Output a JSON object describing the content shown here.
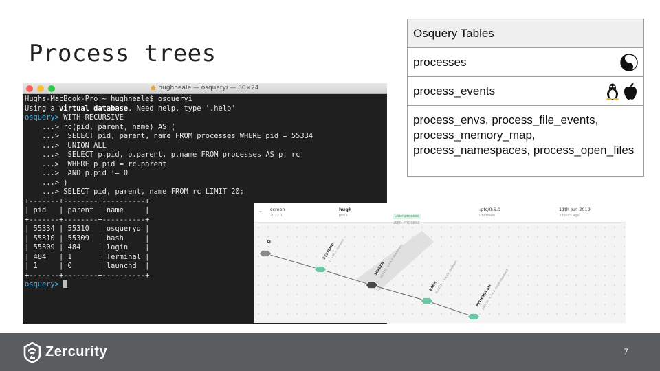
{
  "slide": {
    "title": "Process trees",
    "page_number": "7"
  },
  "terminal": {
    "window_title": "hughneale — osqueryi — 80×24",
    "lines": [
      "Hughs-MacBook-Pro:~ hughneale$ osqueryi",
      "Using a virtual database. Need help, type '.help'",
      "osquery> WITH RECURSIVE",
      "    ...> rc(pid, parent, name) AS (",
      "    ...>  SELECT pid, parent, name FROM processes WHERE pid = 55334",
      "    ...>  UNION ALL",
      "    ...>  SELECT p.pid, p.parent, p.name FROM processes AS p, rc",
      "    ...>  WHERE p.pid = rc.parent",
      "    ...>  AND p.pid != 0",
      "    ...> )",
      "    ...> SELECT pid, parent, name FROM rc LIMIT 20;",
      "+-------+--------+----------+",
      "| pid   | parent | name     |",
      "+-------+--------+----------+",
      "| 55334 | 55310  | osqueryd |",
      "| 55310 | 55309  | bash     |",
      "| 55309 | 484    | login    |",
      "| 484   | 1      | Terminal |",
      "| 1     | 0      | launchd  |",
      "+-------+--------+----------+",
      "osquery> "
    ]
  },
  "tables": {
    "header": "Osquery Tables",
    "rows": [
      {
        "text": "processes",
        "icons": [
          "yin-yang-icon"
        ]
      },
      {
        "text": "process_events",
        "icons": [
          "linux-tux-icon",
          "apple-icon"
        ]
      },
      {
        "text": "process_envs, process_file_events, process_memory_map, process_namespaces, process_open_files",
        "icons": []
      }
    ]
  },
  "process_graph": {
    "header": {
      "name": "screen",
      "pid": "207370",
      "user": "hugh",
      "tty": "pts/3",
      "type_badge": "User process",
      "type_code": "USER_PROCESS",
      "terminal": ":pts/0:S.0",
      "terminal_sub": "Unknown",
      "date": "11th Jun 2019",
      "date_sub": "3 hours ago"
    },
    "nodes": [
      {
        "label": "0",
        "sub": "",
        "color": "#8a8a8a"
      },
      {
        "label": "SYSTEMD",
        "sub": "1 · v 16.3 ·/sbin/init",
        "color": "#6cc7a3"
      },
      {
        "label": "SCREEN",
        "sub": "207370 · v 4.6.2 ·/bin/screen",
        "color": "#4a4a4a"
      },
      {
        "label": "BASH",
        "sub": "207372 · v 4.4.19 ·/bin/bash",
        "color": "#6cc7a3"
      },
      {
        "label": "PYTHON3.6M",
        "sub": "209726 · v 3.6.8 ·/usr/bin/python3",
        "color": "#6cc7a3"
      }
    ]
  },
  "footer": {
    "brand": "Zercurity",
    "background": "#5a5d60"
  }
}
